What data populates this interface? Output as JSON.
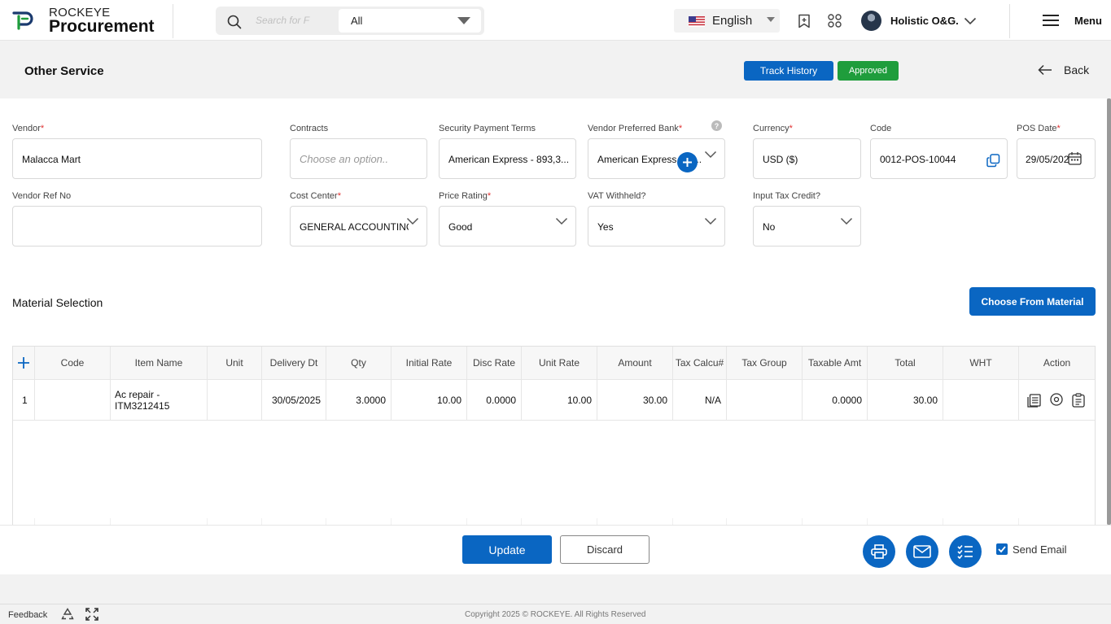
{
  "app": {
    "brand_top": "ROCKEYE",
    "brand_bottom": "Procurement",
    "search_placeholder": "Search for F",
    "search_scope": "All",
    "language": "English",
    "user_name": "Holistic O&G.",
    "menu_label": "Menu"
  },
  "page": {
    "title": "Other Service",
    "track_history": "Track History",
    "status": "Approved",
    "back": "Back"
  },
  "form": {
    "vendor": {
      "label": "Vendor",
      "value": "Malacca Mart"
    },
    "contracts": {
      "label": "Contracts",
      "placeholder": "Choose an option.."
    },
    "security_payment_terms": {
      "label": "Security Payment Terms",
      "value": "American Express - 893,3..."
    },
    "vendor_preferred_bank": {
      "label": "Vendor Preferred Bank",
      "value": "American Express - 98..."
    },
    "currency": {
      "label": "Currency",
      "value": "USD ($)"
    },
    "code": {
      "label": "Code",
      "value": "0012-POS-10044"
    },
    "pos_date": {
      "label": "POS Date",
      "value": "29/05/2025"
    },
    "vendor_ref_no": {
      "label": "Vendor Ref No",
      "value": ""
    },
    "cost_center": {
      "label": "Cost Center",
      "value": "GENERAL ACCOUNTING"
    },
    "price_rating": {
      "label": "Price Rating",
      "value": "Good"
    },
    "vat_withheld": {
      "label": "VAT Withheld?",
      "value": "Yes"
    },
    "input_tax_credit": {
      "label": "Input Tax Credit?",
      "value": "No"
    }
  },
  "material": {
    "title": "Material Selection",
    "choose_button": "Choose From Material",
    "columns": [
      "Code",
      "Item Name",
      "Unit",
      "Delivery Dt",
      "Qty",
      "Initial Rate",
      "Disc Rate",
      "Unit Rate",
      "Amount",
      "Tax Calcu#",
      "Tax Group",
      "Taxable Amt",
      "Total",
      "WHT",
      "Action"
    ],
    "rows": [
      {
        "index": "1",
        "code": "",
        "item_name_line1": "Ac repair -",
        "item_name_line2": "ITM3212415",
        "unit": "",
        "delivery_dt": "30/05/2025",
        "qty": "3.0000",
        "initial_rate": "10.00",
        "disc_rate": "0.0000",
        "unit_rate": "10.00",
        "amount": "30.00",
        "tax_calc": "N/A",
        "tax_group": "",
        "taxable_amt": "0.0000",
        "total": "30.00",
        "wht": ""
      }
    ]
  },
  "actions": {
    "update": "Update",
    "discard": "Discard",
    "send_email": "Send Email",
    "send_email_checked": true
  },
  "footer": {
    "feedback": "Feedback",
    "copyright": "Copyright 2025 © ROCKEYE. All Rights Reserved"
  },
  "colors": {
    "primary": "#0a66c2",
    "approved": "#1f9d3c",
    "required": "#e03030"
  }
}
